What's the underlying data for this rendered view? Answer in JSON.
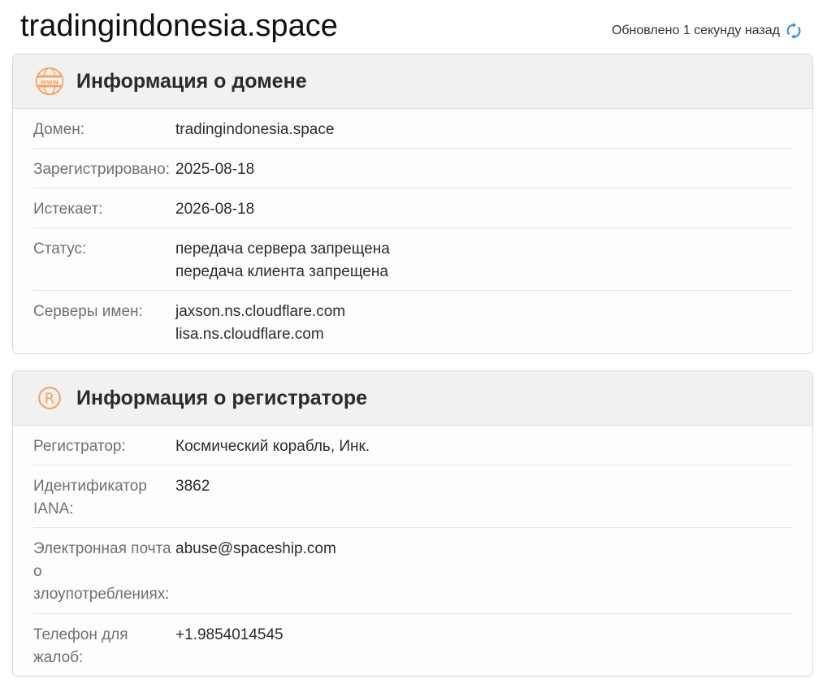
{
  "header": {
    "site_title": "tradingindonesia.space",
    "updated_text": "Обновлено 1 секунду назад",
    "refresh_icon": "refresh-icon",
    "accent_color": "#3d8fe0"
  },
  "domain_card": {
    "title": "Информация о домене",
    "icon": "www-globe-icon",
    "icon_color": "#f4a261",
    "rows": [
      {
        "label": "Домен:",
        "values": [
          "tradingindonesia.space"
        ]
      },
      {
        "label": "Зарегистрировано:",
        "values": [
          "2025-08-18"
        ]
      },
      {
        "label": "Истекает:",
        "values": [
          "2026-08-18"
        ]
      },
      {
        "label": "Статус:",
        "values": [
          "передача сервера запрещена",
          "передача клиента запрещена"
        ]
      },
      {
        "label": "Серверы имен:",
        "values": [
          "jaxson.ns.cloudflare.com",
          "lisa.ns.cloudflare.com"
        ]
      }
    ]
  },
  "registrar_card": {
    "title": "Информация о регистраторе",
    "icon": "registered-trademark-icon",
    "icon_color": "#f4a261",
    "rows": [
      {
        "label": "Регистратор:",
        "values": [
          "Космический корабль, Инк."
        ]
      },
      {
        "label": "Идентификатор IANA:",
        "values": [
          "3862"
        ]
      },
      {
        "label": "Электронная почта о злоупотреблениях:",
        "values": [
          "abuse@spaceship.com"
        ]
      },
      {
        "label": "Телефон для жалоб:",
        "values": [
          "+1.9854014545"
        ]
      }
    ]
  }
}
